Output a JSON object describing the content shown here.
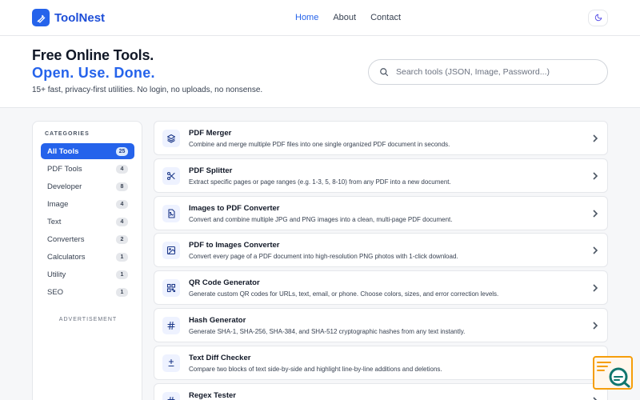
{
  "header": {
    "logo_text": "ToolNest",
    "nav": [
      {
        "label": "Home",
        "active": true
      },
      {
        "label": "About",
        "active": false
      },
      {
        "label": "Contact",
        "active": false
      }
    ],
    "theme_icon": "moon-icon"
  },
  "hero": {
    "title_line1": "Free Online Tools.",
    "title_line2": "Open. Use. Done.",
    "subtitle": "15+ fast, privacy-first utilities. No login, no uploads, no nonsense.",
    "search_placeholder": "Search tools (JSON, Image, Password...)",
    "search_value": ""
  },
  "sidebar": {
    "heading": "CATEGORIES",
    "items": [
      {
        "label": "All Tools",
        "count": "25",
        "active": true
      },
      {
        "label": "PDF Tools",
        "count": "4",
        "active": false
      },
      {
        "label": "Developer",
        "count": "8",
        "active": false
      },
      {
        "label": "Image",
        "count": "4",
        "active": false
      },
      {
        "label": "Text",
        "count": "4",
        "active": false
      },
      {
        "label": "Converters",
        "count": "2",
        "active": false
      },
      {
        "label": "Calculators",
        "count": "1",
        "active": false
      },
      {
        "label": "Utility",
        "count": "1",
        "active": false
      },
      {
        "label": "SEO",
        "count": "1",
        "active": false
      }
    ],
    "ad_label": "ADVERTISEMENT"
  },
  "tools": [
    {
      "name": "PDF Merger",
      "desc": "Combine and merge multiple PDF files into one single organized PDF document in seconds.",
      "icon": "layers-icon"
    },
    {
      "name": "PDF Splitter",
      "desc": "Extract specific pages or page ranges (e.g. 1-3, 5, 8-10) from any PDF into a new document.",
      "icon": "scissors-icon"
    },
    {
      "name": "Images to PDF Converter",
      "desc": "Convert and combine multiple JPG and PNG images into a clean, multi-page PDF document.",
      "icon": "image-file-icon"
    },
    {
      "name": "PDF to Images Converter",
      "desc": "Convert every page of a PDF document into high-resolution PNG photos with 1-click download.",
      "icon": "image-icon"
    },
    {
      "name": "QR Code Generator",
      "desc": "Generate custom QR codes for URLs, text, email, or phone. Choose colors, sizes, and error correction levels.",
      "icon": "qr-code-icon"
    },
    {
      "name": "Hash Generator",
      "desc": "Generate SHA-1, SHA-256, SHA-384, and SHA-512 cryptographic hashes from any text instantly.",
      "icon": "hash-icon"
    },
    {
      "name": "Text Diff Checker",
      "desc": "Compare two blocks of text side-by-side and highlight line-by-line additions and deletions.",
      "icon": "plus-minus-icon"
    },
    {
      "name": "Regex Tester",
      "desc": "",
      "icon": "hash-icon"
    }
  ],
  "colors": {
    "accent": "#2563eb",
    "border": "#e5e7eb",
    "widget": "#f59e0b"
  }
}
